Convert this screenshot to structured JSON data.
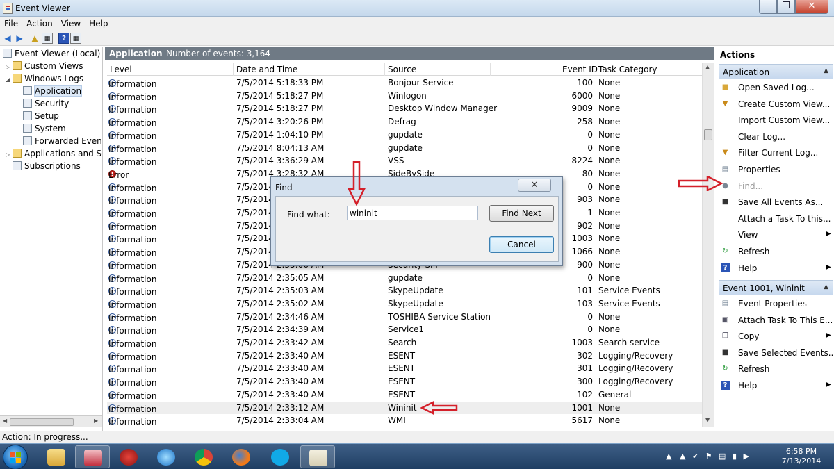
{
  "window": {
    "title": "Event Viewer"
  },
  "menu": [
    "File",
    "Action",
    "View",
    "Help"
  ],
  "tree": {
    "items": [
      {
        "label": "Event Viewer (Local)"
      },
      {
        "label": "Custom Views"
      },
      {
        "label": "Windows Logs"
      },
      {
        "label": "Application"
      },
      {
        "label": "Security"
      },
      {
        "label": "Setup"
      },
      {
        "label": "System"
      },
      {
        "label": "Forwarded Events"
      },
      {
        "label": "Applications and Serv"
      },
      {
        "label": "Subscriptions"
      }
    ]
  },
  "log": {
    "name": "Application",
    "count_text": "Number of events: 3,164"
  },
  "columns": {
    "level": "Level",
    "datetime": "Date and Time",
    "source": "Source",
    "eventid": "Event ID",
    "category": "Task Category"
  },
  "events": [
    {
      "level": "Information",
      "datetime": "7/5/2014 5:18:33 PM",
      "source": "Bonjour Service",
      "eventid": "100",
      "category": "None"
    },
    {
      "level": "Information",
      "datetime": "7/5/2014 5:18:27 PM",
      "source": "Winlogon",
      "eventid": "6000",
      "category": "None"
    },
    {
      "level": "Information",
      "datetime": "7/5/2014 5:18:27 PM",
      "source": "Desktop Window Manager",
      "eventid": "9009",
      "category": "None"
    },
    {
      "level": "Information",
      "datetime": "7/5/2014 3:20:26 PM",
      "source": "Defrag",
      "eventid": "258",
      "category": "None"
    },
    {
      "level": "Information",
      "datetime": "7/5/2014 1:04:10 PM",
      "source": "gupdate",
      "eventid": "0",
      "category": "None"
    },
    {
      "level": "Information",
      "datetime": "7/5/2014 8:04:13 AM",
      "source": "gupdate",
      "eventid": "0",
      "category": "None"
    },
    {
      "level": "Information",
      "datetime": "7/5/2014 3:36:29 AM",
      "source": "VSS",
      "eventid": "8224",
      "category": "None"
    },
    {
      "level": "Error",
      "datetime": "7/5/2014 3:28:32 AM",
      "source": "SideBySide",
      "eventid": "80",
      "category": "None"
    },
    {
      "level": "Information",
      "datetime": "7/5/2014",
      "source": "",
      "eventid": "0",
      "category": "None"
    },
    {
      "level": "Information",
      "datetime": "7/5/2014",
      "source": "",
      "eventid": "903",
      "category": "None"
    },
    {
      "level": "Information",
      "datetime": "7/5/2014",
      "source": "",
      "eventid": "1",
      "category": "None"
    },
    {
      "level": "Information",
      "datetime": "7/5/2014",
      "source": "",
      "eventid": "902",
      "category": "None"
    },
    {
      "level": "Information",
      "datetime": "7/5/2014",
      "source": "",
      "eventid": "1003",
      "category": "None"
    },
    {
      "level": "Information",
      "datetime": "7/5/2014",
      "source": "",
      "eventid": "1066",
      "category": "None"
    },
    {
      "level": "Information",
      "datetime": "7/5/2014 2:35:06 AM",
      "source": "Security-SPP",
      "eventid": "900",
      "category": "None"
    },
    {
      "level": "Information",
      "datetime": "7/5/2014 2:35:05 AM",
      "source": "gupdate",
      "eventid": "0",
      "category": "None"
    },
    {
      "level": "Information",
      "datetime": "7/5/2014 2:35:03 AM",
      "source": "SkypeUpdate",
      "eventid": "101",
      "category": "Service Events"
    },
    {
      "level": "Information",
      "datetime": "7/5/2014 2:35:02 AM",
      "source": "SkypeUpdate",
      "eventid": "103",
      "category": "Service Events"
    },
    {
      "level": "Information",
      "datetime": "7/5/2014 2:34:46 AM",
      "source": "TOSHIBA Service Station",
      "eventid": "0",
      "category": "None"
    },
    {
      "level": "Information",
      "datetime": "7/5/2014 2:34:39 AM",
      "source": "Service1",
      "eventid": "0",
      "category": "None"
    },
    {
      "level": "Information",
      "datetime": "7/5/2014 2:33:42 AM",
      "source": "Search",
      "eventid": "1003",
      "category": "Search service"
    },
    {
      "level": "Information",
      "datetime": "7/5/2014 2:33:40 AM",
      "source": "ESENT",
      "eventid": "302",
      "category": "Logging/Recovery"
    },
    {
      "level": "Information",
      "datetime": "7/5/2014 2:33:40 AM",
      "source": "ESENT",
      "eventid": "301",
      "category": "Logging/Recovery"
    },
    {
      "level": "Information",
      "datetime": "7/5/2014 2:33:40 AM",
      "source": "ESENT",
      "eventid": "300",
      "category": "Logging/Recovery"
    },
    {
      "level": "Information",
      "datetime": "7/5/2014 2:33:40 AM",
      "source": "ESENT",
      "eventid": "102",
      "category": "General"
    },
    {
      "level": "Information",
      "datetime": "7/5/2014 2:33:12 AM",
      "source": "Wininit",
      "eventid": "1001",
      "category": "None"
    },
    {
      "level": "Information",
      "datetime": "7/5/2014 2:33:04 AM",
      "source": "WMI",
      "eventid": "5617",
      "category": "None"
    }
  ],
  "actions": {
    "title": "Actions",
    "section1": "Application",
    "items1": [
      {
        "label": "Open Saved Log...",
        "icon": "folder-icon"
      },
      {
        "label": "Create Custom View...",
        "icon": "filter-icon"
      },
      {
        "label": "Import Custom View...",
        "icon": ""
      },
      {
        "label": "Clear Log...",
        "icon": ""
      },
      {
        "label": "Filter Current Log...",
        "icon": "filter-icon"
      },
      {
        "label": "Properties",
        "icon": "properties-icon"
      },
      {
        "label": "Find...",
        "icon": "binoculars-icon"
      },
      {
        "label": "Save All Events As...",
        "icon": "save-icon"
      },
      {
        "label": "Attach a Task To this...",
        "icon": ""
      },
      {
        "label": "View",
        "icon": ""
      },
      {
        "label": "Refresh",
        "icon": "refresh-icon"
      },
      {
        "label": "Help",
        "icon": "help-icon"
      }
    ],
    "section2": "Event 1001, Wininit",
    "items2": [
      {
        "label": "Event Properties",
        "icon": "properties-icon"
      },
      {
        "label": "Attach Task To This E...",
        "icon": "task-icon"
      },
      {
        "label": "Copy",
        "icon": "copy-icon"
      },
      {
        "label": "Save Selected Events...",
        "icon": "save-icon"
      },
      {
        "label": "Refresh",
        "icon": "refresh-icon"
      },
      {
        "label": "Help",
        "icon": "help-icon"
      }
    ]
  },
  "find_dialog": {
    "title": "Find",
    "label": "Find what:",
    "value": "wininit",
    "find_next": "Find Next",
    "cancel": "Cancel"
  },
  "status": {
    "text": "Action:  In progress..."
  },
  "taskbar": {
    "time": "6:58 PM",
    "date": "7/13/2014"
  },
  "colors": {
    "annotation": "#d4202a",
    "header": "#6f7a85",
    "section": "#c6d8ee"
  }
}
